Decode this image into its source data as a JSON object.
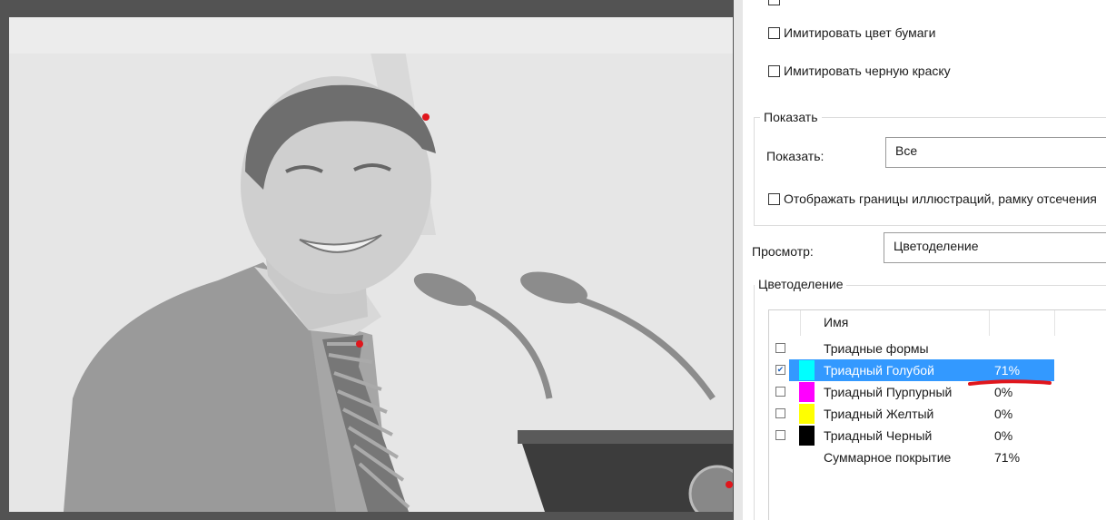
{
  "options": {
    "simulate_paper": "Имитировать цвет бумаги",
    "simulate_black_ink": "Имитировать черную краску"
  },
  "show_group": {
    "title": "Показать",
    "show_label": "Показать:",
    "show_value": "Все",
    "borders_checkbox": "Отображать границы иллюстраций, рамку отсечения"
  },
  "preview": {
    "label": "Просмотр:",
    "value": "Цветоделение"
  },
  "separations": {
    "title": "Цветоделение",
    "header_name": "Имя",
    "rows": [
      {
        "name": "Триадные формы",
        "percent": "",
        "color": "",
        "checked": false
      },
      {
        "name": "Триадный Голубой",
        "percent": "71%",
        "color": "#00ffff",
        "checked": true
      },
      {
        "name": "Триадный Пурпурный",
        "percent": "0%",
        "color": "#ff00ff",
        "checked": false
      },
      {
        "name": "Триадный Желтый",
        "percent": "0%",
        "color": "#ffff00",
        "checked": false
      },
      {
        "name": "Триадный Черный",
        "percent": "0%",
        "color": "#000000",
        "checked": false
      },
      {
        "name": "Суммарное покрытие",
        "percent": "71%",
        "color": "",
        "checked": false
      }
    ],
    "selected_color": "#3399ff",
    "annotation_color": "#e0161c"
  }
}
